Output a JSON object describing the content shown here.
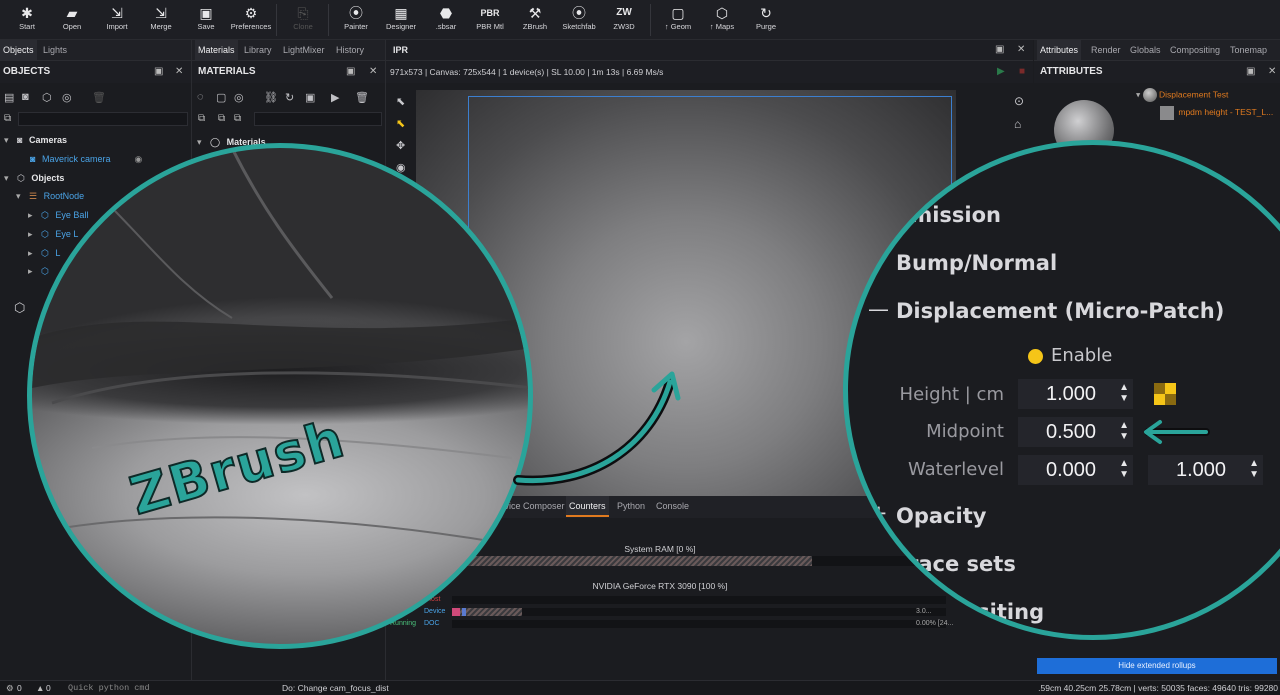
{
  "toolbar": {
    "buttons": [
      {
        "label": "Start",
        "icon": "start-icon"
      },
      {
        "label": "Open",
        "icon": "open-folder-icon"
      },
      {
        "label": "Import",
        "icon": "import-icon"
      },
      {
        "label": "Merge",
        "icon": "merge-icon"
      },
      {
        "label": "Save",
        "icon": "save-icon"
      },
      {
        "label": "Preferences",
        "icon": "gear-icon"
      },
      {
        "label": "Clone",
        "icon": "clone-icon"
      },
      {
        "label": "Painter",
        "icon": "painter-icon"
      },
      {
        "label": "Designer",
        "icon": "designer-icon"
      },
      {
        "label": ".sbsar",
        "icon": "sbsar-icon"
      },
      {
        "label": "PBR Mtl",
        "icon": "pbr-icon"
      },
      {
        "label": "ZBrush",
        "icon": "zbrush-icon"
      },
      {
        "label": "Sketchfab",
        "icon": "sketchfab-icon"
      },
      {
        "label": "ZW3D",
        "icon": "zw3d-icon"
      },
      {
        "label": "↑ Geom",
        "icon": "geom-icon"
      },
      {
        "label": "↑ Maps",
        "icon": "maps-icon"
      },
      {
        "label": "Purge",
        "icon": "purge-icon"
      }
    ],
    "icon_glyphs": [
      "✱",
      "▰",
      "⇲",
      "⇲",
      "▣",
      "⚙",
      "⎘",
      "⦿",
      "▦",
      "⬣",
      "PBR",
      "⚒",
      "⦿",
      "ZW",
      "▢",
      "⬡",
      "↻"
    ]
  },
  "objects_panel": {
    "tabs": [
      "Objects",
      "Lights"
    ],
    "title": "OBJECTS",
    "tree": [
      {
        "label": "Cameras",
        "level": 0,
        "bold": true
      },
      {
        "label": "Maverick camera",
        "level": 1
      },
      {
        "label": "Objects",
        "level": 0,
        "bold": true
      },
      {
        "label": "RootNode",
        "level": 1
      },
      {
        "label": "Eye Ball",
        "level": 2
      },
      {
        "label": "Eye L",
        "level": 2
      },
      {
        "label": "L",
        "level": 2
      },
      {
        "label": "",
        "level": 2
      }
    ]
  },
  "materials_panel": {
    "tabs": [
      "Materials",
      "Library",
      "LightMixer",
      "History"
    ],
    "title": "MATERIALS",
    "tree_item": "Materials"
  },
  "viewport": {
    "title": "IPR",
    "info": "971x573  |  Canvas: 725x544  |  1 device(s)  |  SL 10.00  |  1m 13s  |  6.69 Ms/s"
  },
  "counters": {
    "tabs": [
      "Device Composer",
      "Counters",
      "Python",
      "Console"
    ],
    "active_tab": "Counters",
    "system_ram_label": "System RAM  [0 %]",
    "gpu_label": "NVIDIA GeForce RTX 3090  [100 %]",
    "rows": [
      {
        "left": "",
        "tag": "Host",
        "value": ""
      },
      {
        "left": "",
        "tag": "Device",
        "value": "3.0..."
      },
      {
        "left": "Running",
        "tag": "DOC",
        "value": "0.00% [24..."
      }
    ]
  },
  "attributes": {
    "tabs": [
      "Attributes",
      "Render",
      "Globals",
      "Compositing",
      "Tonemap"
    ],
    "title": "ATTRIBUTES",
    "material_name": "Displacement Test",
    "map_name": "mpdm height - TEST_L...",
    "hide_button": "Hide extended rollups"
  },
  "zoom_panel": {
    "sections": [
      "Emission",
      "Bump/Normal",
      "Displacement (Micro-Patch)",
      "Opacity",
      "Trace sets",
      "Compositing"
    ],
    "enable_label": "Enable",
    "params": [
      {
        "label": "Height | cm",
        "value": "1.000"
      },
      {
        "label": "Midpoint",
        "value": "0.500"
      },
      {
        "label": "Waterlevel",
        "value": "0.000",
        "value2": "1.000"
      }
    ]
  },
  "annotation": {
    "text": "ZBrush",
    "color": "#2aa49a"
  },
  "status": {
    "warnings": "0",
    "errors": "0",
    "python_placeholder": "Quick python cmd",
    "message": "Do: Change cam_focus_dist",
    "stats": ".59cm 40.25cm 25.78cm  |  verts: 50035  faces: 49640  tris: 99280"
  },
  "colors": {
    "accent_teal": "#2aa49a",
    "select_blue": "#3c7fcf",
    "link_blue": "#4aa3e6",
    "orange": "#e07a1f",
    "yellow": "#f5c518"
  }
}
